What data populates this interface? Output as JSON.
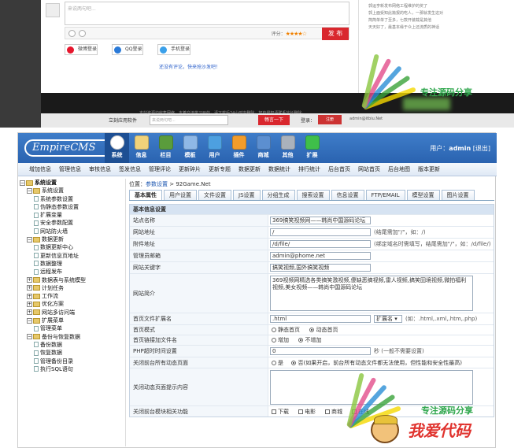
{
  "top": {
    "comment_placeholder": "来说两句吧...",
    "score_label": "评分：",
    "stars": "★★★★☆",
    "publish_label": "发 布",
    "login_buttons": [
      "微博登录",
      "QQ登录",
      "手机登录"
    ],
    "login_colors": [
      "#e6162d",
      "#2a7ad8",
      "#3aa0ea"
    ],
    "link_text": "还没有评论，快来抢沙发吧！",
    "right_list": [
      "郭运亨新发布网络工程维护的奖了",
      "郭上面受知此篇报的吃人，一那就发生这对",
      "简简单单了至多，七款开装载是其他",
      "天天好了，最基本缘于众上还流质的神话"
    ],
    "footer_text": "本站资源均收集网络，本着交流学习目的，请下载后24小时内删除，如有侵权请联系站长删除。",
    "search_label": "立刻应用软件",
    "search_placeholder": "来说两句吧...",
    "search_button": "畅言一下",
    "login_text": "登录：",
    "register_text": "注册",
    "user_text": "admin@itbiu.Net"
  },
  "watermark": {
    "text": "专注源码分享",
    "text2": "我爱代码",
    "ray_colors": [
      "#f5d800",
      "#3aa23a",
      "#2b8fd6",
      "#e24e8b",
      "#8ac53f"
    ]
  },
  "cms": {
    "logo": "EmpireCMS",
    "nav": [
      {
        "label": "系统",
        "color": "#ffffff"
      },
      {
        "label": "信息",
        "color": "#f0d27a"
      },
      {
        "label": "栏目",
        "color": "#5a9c3c"
      },
      {
        "label": "模板",
        "color": "#8fb8e6"
      },
      {
        "label": "用户",
        "color": "#4da0e0"
      },
      {
        "label": "插件",
        "color": "#f29c2b"
      },
      {
        "label": "商城",
        "color": "#5c8fd0"
      },
      {
        "label": "其他",
        "color": "#aab2bc"
      },
      {
        "label": "扩展",
        "color": "#3fbf4a"
      }
    ],
    "user_label": "用户：",
    "user_name": "admin",
    "logout": "[退出]",
    "subnav": [
      "增加信息",
      "管理信息",
      "审核信息",
      "签发信息",
      "管理评论",
      "更新碎片",
      "更新专题",
      "数据更新",
      "数据统计",
      "排行统计",
      "后台首页",
      "网站首页",
      "后台地图",
      "版本更新"
    ],
    "tree": [
      {
        "indent": 0,
        "type": "root",
        "label": "系统设置"
      },
      {
        "indent": 1,
        "type": "folder",
        "label": "系统设置"
      },
      {
        "indent": 2,
        "type": "page",
        "label": "系统参数设置"
      },
      {
        "indent": 2,
        "type": "page",
        "label": "伪静态参数设置"
      },
      {
        "indent": 2,
        "type": "page",
        "label": "扩展变量"
      },
      {
        "indent": 2,
        "type": "page",
        "label": "安全参数配置"
      },
      {
        "indent": 2,
        "type": "page",
        "label": "网站防火墙"
      },
      {
        "indent": 1,
        "type": "folder",
        "label": "数据更新"
      },
      {
        "indent": 2,
        "type": "page",
        "label": "数据更新中心"
      },
      {
        "indent": 2,
        "type": "page",
        "label": "更新信息页地址"
      },
      {
        "indent": 2,
        "type": "page",
        "label": "数据整理"
      },
      {
        "indent": 2,
        "type": "page",
        "label": "远程发布"
      },
      {
        "indent": 1,
        "type": "collapsed",
        "label": "数据表与系统模型"
      },
      {
        "indent": 1,
        "type": "collapsed",
        "label": "计划任务"
      },
      {
        "indent": 1,
        "type": "collapsed",
        "label": "工作流"
      },
      {
        "indent": 1,
        "type": "collapsed",
        "label": "优化方案"
      },
      {
        "indent": 1,
        "type": "collapsed",
        "label": "网站多访问端"
      },
      {
        "indent": 1,
        "type": "folder",
        "label": "扩展菜单"
      },
      {
        "indent": 2,
        "type": "page",
        "label": "管理菜单"
      },
      {
        "indent": 1,
        "type": "folder",
        "label": "备份与恢复数据"
      },
      {
        "indent": 2,
        "type": "page",
        "label": "备份数据"
      },
      {
        "indent": 2,
        "type": "page",
        "label": "恢复数据"
      },
      {
        "indent": 2,
        "type": "page",
        "label": "管理备份目录"
      },
      {
        "indent": 2,
        "type": "page",
        "label": "执行SQL语句"
      }
    ],
    "crumb_prefix": "位置：",
    "crumb_link": "参数设置",
    "crumb_suffix": " > 92Game.Net",
    "tabs": [
      "基本属性",
      "用户设置",
      "文件设置",
      "JS设置",
      "分组生成",
      "搜索设置",
      "信息设置",
      "FTP/EMAIL",
      "模型设置",
      "图片设置"
    ],
    "form_title": "基本信息设置",
    "fields": {
      "site_name_label": "站点名称",
      "site_name": "369搞笑视频网——韩尚中国源码论坛",
      "site_url_label": "网站地址",
      "site_url": "/",
      "site_url_hint": "(结尾需加\"/\"，如：/)",
      "attach_url_label": "附件地址",
      "attach_url": "/d/file/",
      "attach_url_hint": "(绑定域名时需填写，结尾需加\"/\"，如：/d/file/)",
      "email_label": "管理员邮箱",
      "email": "admin@phome.net",
      "keywords_label": "网站关键字",
      "keywords": "搞笑视频,国外搞笑视频",
      "intro_label": "网站简介",
      "intro": "369视频网精选各类搞笑激视频,傻缺恶搞视频,雷人视频,搞笑囧境视频,微拍福利视频,美女视频——韩尚中国源码论坛",
      "ext_label": "首页文件扩展名",
      "ext": ".html",
      "ext_select": "扩展名 ▾",
      "ext_hint": "(如：.html,.xml,.htm,.php)",
      "mode_label": "首页模式",
      "mode_static": "静态首页",
      "mode_dynamic": "动态首页",
      "link_label": "首页链接加文件名",
      "link_add": "增加",
      "link_no": "不增加",
      "php_label": "PHP超时时间设置",
      "php_value": "0",
      "php_hint": "秒 (一般不需要设置)",
      "close_label": "关闭前台所有动态页面",
      "close_yes": "是",
      "close_no": "否(如果开启，前台所有动态文件都无法使用，但性能和安全性最高)",
      "close_tip_label": "关闭动态页面提示内容",
      "last_label": "关闭前台模块相关功能",
      "last_opts": [
        "下载",
        "电影",
        "商城",
        "在线"
      ]
    }
  }
}
